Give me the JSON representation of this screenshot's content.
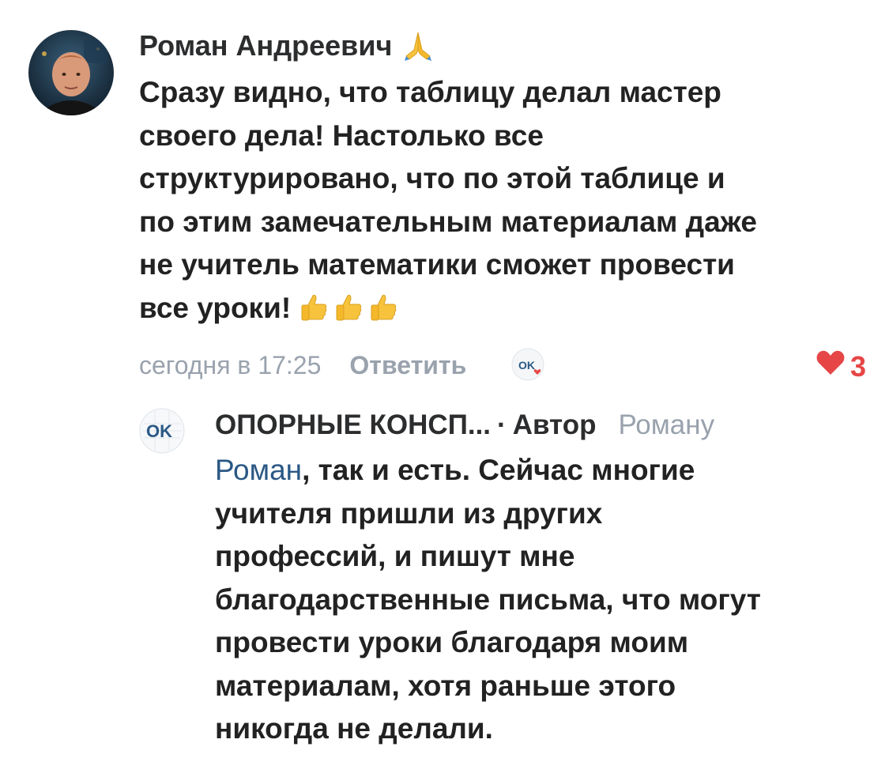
{
  "comment": {
    "author": "Роман Андреевич",
    "author_emoji_icon": "folded-hands-icon",
    "text": "Сразу видно, что таблицу делал мастер\nсвоего дела! Настолько все\nструктурировано, что по этой таблице и\nпо этим замечательным материалам даже\nне учитель математики сможет провести\nвсе уроки!",
    "trailing_emoji_icons": [
      "thumbs-up-icon",
      "thumbs-up-icon",
      "thumbs-up-icon"
    ],
    "time": "сегодня в 17:25",
    "reply_label": "Ответить",
    "like_count": "3",
    "like_color": "#e64646"
  },
  "reply": {
    "author": "ОПОРНЫЕ КОНСП...",
    "separator": "·",
    "author_badge": "Автор",
    "reply_to": "Роману",
    "mention": "Роман",
    "text": ", так и есть. Сейчас многие\nучителя пришли из других\nпрофессий, и пишут мне\nблагодарственные письма, что могут\nпровести уроки благодаря моим\nматериалам, хотя раньше этого\nникогда не делали."
  },
  "colors": {
    "text": "#222222",
    "muted": "#99a2ad",
    "link": "#2a5885",
    "like": "#e64646"
  }
}
